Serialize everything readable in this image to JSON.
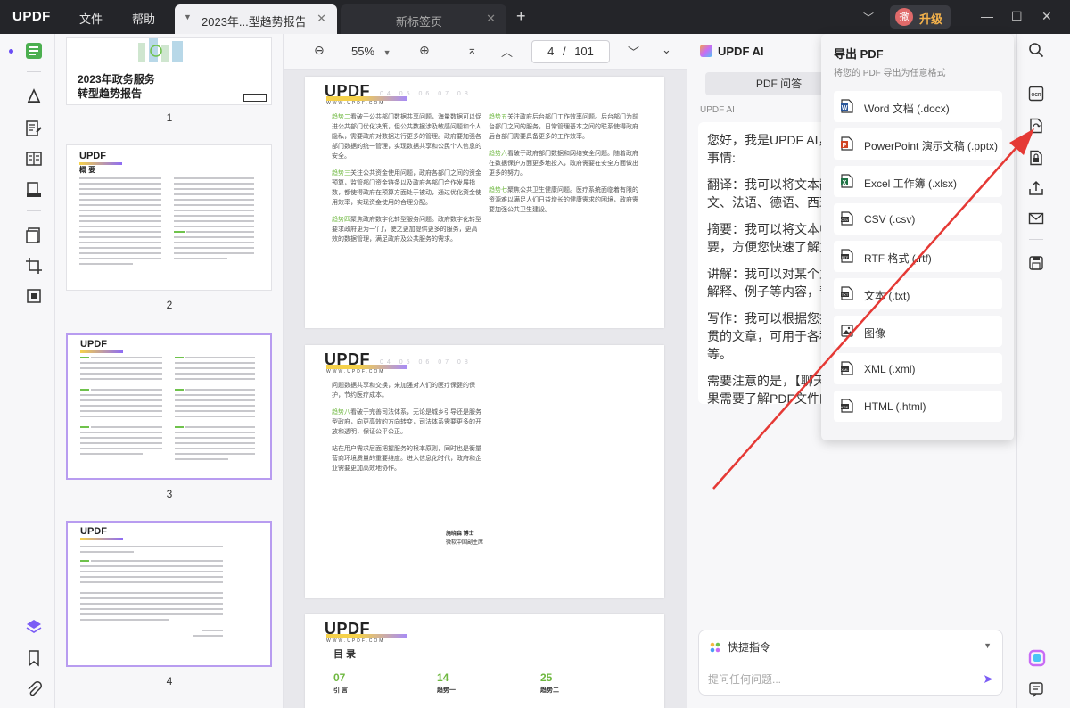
{
  "app": {
    "logo": "UPDF",
    "menu_file": "文件",
    "menu_help": "帮助",
    "upgrade_label": "升级",
    "avatar": "撒"
  },
  "tabs": [
    {
      "label": "2023年...型趋势报告",
      "active": true
    },
    {
      "label": "新标签页",
      "active": false
    }
  ],
  "toolbar": {
    "zoom": "55%",
    "page_current": "4",
    "page_sep": "/",
    "page_total": "101"
  },
  "thumbnails": [
    {
      "number": "1",
      "title_line1": "2023年政务服务",
      "title_line2": "转型趋势报告"
    },
    {
      "number": "2",
      "heading": "概 要"
    },
    {
      "number": "3"
    },
    {
      "number": "4"
    }
  ],
  "doc": {
    "logo": "UPDF",
    "logo_sub": "WWW.UPDF.COM",
    "logo_nums": "04 05 06 07 08",
    "p1_left": [
      {
        "tag": "趋势二",
        "text": "看破于公共部门数据共享问题，海量数据可以促进公共部门优化决策，但公共数据涉及敏感问题和个人隐私，需要政府对数据进行更多的管理。政府要加强各部门数据的统一管理，实现数据共享和公民个人信息的安全。"
      },
      {
        "tag": "趋势三",
        "text": "关注公共资金使用问题，政府各部门之间的资金预算，监管部门资金链条以及政府各部门合作发展指数，都使得政府在预算方面处于被动，通过优化资金使用效率，实现资金使用的合理分配。"
      },
      {
        "tag": "趋势四",
        "text": "聚焦政府数字化转型服务问题。政府数字化转型要求政府更为一'门'，使之更加提供更多的服务，更高效的数据管理，满足政府及公共服务的需求。"
      }
    ],
    "p1_right": [
      {
        "tag": "趋势五",
        "text": "关注政府后台部门工作效率问题。后台部门为前台部门之间的服务，日常管理基本之间的联系使得政府后台部门需要具备更多的工作效率。"
      },
      {
        "tag": "趋势六",
        "text": "看破于政府部门数据和网络安全问题。随着政府在数据保护方面更多地投入，政府需要在安全方面做出更多的努力。"
      },
      {
        "tag": "趋势七",
        "text": "聚焦公共卫生健康问题。医疗系统面临着有限的资源难以满足人们日益增长的健康需求的困境，政府需要加强公共卫生建设。"
      }
    ],
    "p2_left": [
      {
        "tag": "",
        "text": "问题数据共享和交换，来加强对人们的医疗保健的保护，节约医疗成本。"
      },
      {
        "tag": "趋势八",
        "text": "看破于完善司法体系，无论是城乡引导还是服务型政府，向更高效的方向转变，司法体系需要更多的开放和透明，保证公平公正。"
      },
      {
        "tag": "",
        "text": "站在用户需求层面把握服务的根本原则，同时也是衡量营商环境质量的重要维度。进入信息化时代，政府和企业需要更加高效地协作。"
      }
    ],
    "p2_sign": "施晓森  博士",
    "p2_sign_org": "微软中国副主席",
    "p3_heading": "目 录",
    "p3_items": [
      {
        "num": "07",
        "label": "引 言"
      },
      {
        "num": "14",
        "label": "趋势一"
      },
      {
        "num": "25",
        "label": "趋势二"
      }
    ]
  },
  "ai": {
    "title": "UPDF AI",
    "tab": "PDF 问答",
    "label": "UPDF AI",
    "messages": [
      "您好，我是UPDF AI，您的",
      "事情:",
      "翻译：我可以将文本翻译成",
      "文、法语、德语、西班牙语",
      "摘要：我可以将文本中的主",
      "要，方便您快速了解文本内",
      "讲解：我可以对某个主题或",
      "解释、例子等内容，帮助您",
      "写作：我可以根据您提供的",
      "贯的文章，可用于各种场合",
      "等。",
      "需要注意的是，【聊天】功",
      "果需要了解PDF文件的内容"
    ],
    "quick_cmd": "快捷指令",
    "placeholder": "提问任何问题..."
  },
  "export": {
    "title": "导出 PDF",
    "subtitle": "将您的 PDF 导出为任意格式",
    "options": [
      {
        "label": "Word 文档 (.docx)",
        "icon": "word-icon",
        "color": "#2b579a"
      },
      {
        "label": "PowerPoint 演示文稿 (.pptx)",
        "icon": "powerpoint-icon",
        "color": "#d04423"
      },
      {
        "label": "Excel 工作簿 (.xlsx)",
        "icon": "excel-icon",
        "color": "#217346"
      },
      {
        "label": "CSV (.csv)",
        "icon": "csv-icon",
        "color": "#333333"
      },
      {
        "label": "RTF 格式 (.rtf)",
        "icon": "rtf-icon",
        "color": "#333333"
      },
      {
        "label": "文本 (.txt)",
        "icon": "txt-icon",
        "color": "#333333"
      },
      {
        "label": "图像",
        "icon": "image-icon",
        "color": "#333333"
      },
      {
        "label": "XML (.xml)",
        "icon": "xml-icon",
        "color": "#333333"
      },
      {
        "label": "HTML (.html)",
        "icon": "html-icon",
        "color": "#333333"
      }
    ]
  },
  "colors": {
    "accent": "#7b5cf5",
    "arrow": "#e53935",
    "titlebar": "#242529",
    "upgrade": "#f6b34b"
  }
}
